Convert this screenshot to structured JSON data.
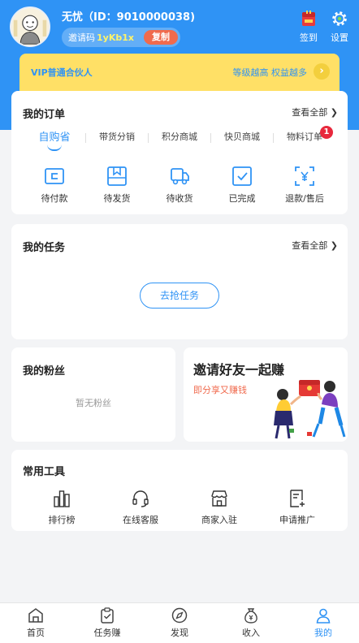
{
  "header": {
    "user_name": "无忧",
    "user_id_text": "（ID：9010000038)",
    "invite_label": "邀请码",
    "invite_code": "1yKb1x",
    "copy_label": "复制",
    "sign_in_label": "签到",
    "settings_label": "设置"
  },
  "vip": {
    "level_text": "VIP普通合伙人",
    "slogan": "等级越高 权益越多"
  },
  "orders": {
    "title": "我的订单",
    "see_all": "查看全部 ❯",
    "tabs": [
      "自购省",
      "带货分销",
      "积分商城",
      "快贝商城",
      "物料订单"
    ],
    "tab_badge": "1",
    "statuses": [
      "待付款",
      "待发货",
      "待收货",
      "已完成",
      "退款/售后"
    ]
  },
  "tasks": {
    "title": "我的任务",
    "see_all": "查看全部 ❯",
    "button": "去抢任务"
  },
  "fans": {
    "title": "我的粉丝",
    "empty": "暂无粉丝"
  },
  "invite_card": {
    "title": "邀请好友一起赚",
    "subtitle": "即分享又赚钱"
  },
  "tools": {
    "title": "常用工具",
    "items": [
      "排行榜",
      "在线客服",
      "商家入驻",
      "申请推广"
    ]
  },
  "nav": {
    "items": [
      "首页",
      "任务赚",
      "发现",
      "收入",
      "我的"
    ]
  },
  "colors": {
    "primary": "#2f93f5",
    "accent": "#f06a4d",
    "vip_bg": "#ffe066",
    "badge": "#e8283c"
  }
}
